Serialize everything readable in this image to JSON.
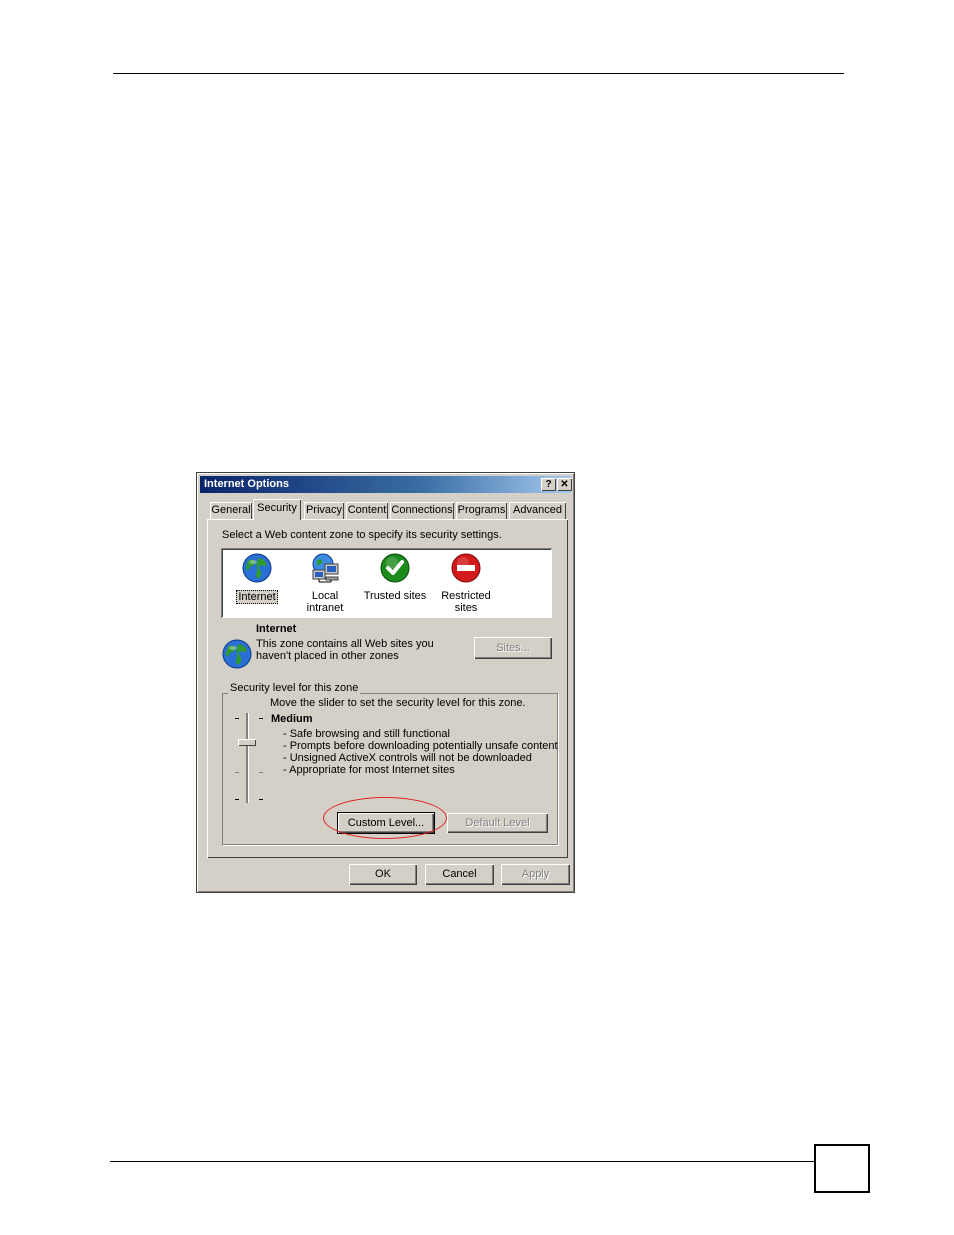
{
  "dialog": {
    "title": "Internet Options",
    "help_glyph": "?",
    "close_glyph": "✕",
    "tabs": [
      "General",
      "Security",
      "Privacy",
      "Content",
      "Connections",
      "Programs",
      "Advanced"
    ],
    "active_tab": "Security",
    "zone_prompt": "Select a Web content zone to specify its security settings.",
    "zones": [
      {
        "label": "Internet",
        "icon": "globe-icon",
        "selected": true
      },
      {
        "label": "Local intranet",
        "icon": "network-computer-icon"
      },
      {
        "label": "Trusted sites",
        "icon": "green-check-icon"
      },
      {
        "label": "Restricted sites",
        "icon": "red-no-entry-icon"
      }
    ],
    "zone_info": {
      "title": "Internet",
      "description": "This zone contains all Web sites you haven't placed in other zones"
    },
    "sites_button": "Sites...",
    "security_group": {
      "legend": "Security level for this zone",
      "slider_hint": "Move the slider to set the security level for this zone.",
      "level_name": "Medium",
      "level_details": [
        "- Safe browsing and still functional",
        "- Prompts before downloading potentially unsafe content",
        "- Unsigned ActiveX controls will not be downloaded",
        "- Appropriate for most Internet sites"
      ],
      "custom_level_button": "Custom Level...",
      "default_level_button": "Default Level"
    },
    "ok_button": "OK",
    "cancel_button": "Cancel",
    "apply_button": "Apply"
  },
  "colors": {
    "titlebar_start": "#0a246a",
    "dialog_face": "#d4d0c8",
    "annotation_ring": "#e02020"
  }
}
